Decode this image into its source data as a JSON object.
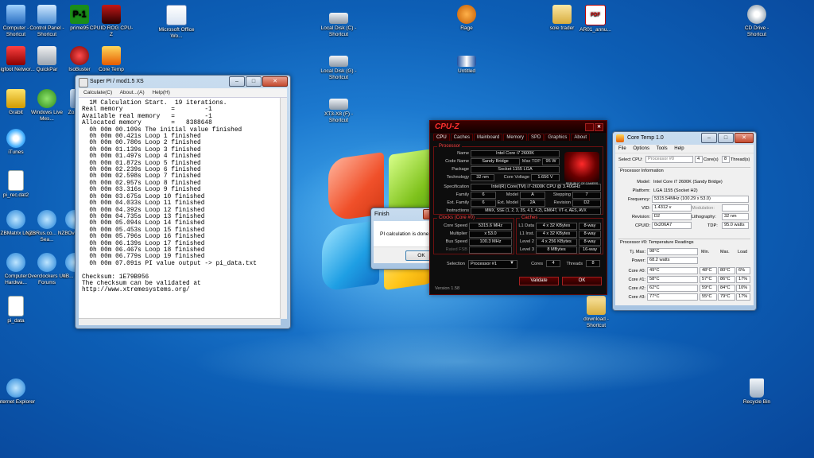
{
  "desktop_icons": [
    {
      "label": "Computer - Shortcut",
      "icon": "computer-icon"
    },
    {
      "label": "Control Panel - Shortcut",
      "icon": "control-panel-icon"
    },
    {
      "label": "prime95",
      "icon": "prime95-icon"
    },
    {
      "label": "CPUID ROG CPU-Z",
      "icon": "cpuz-rog-icon"
    },
    {
      "label": "Microsoft Office Wo...",
      "icon": "word-document-icon"
    },
    {
      "label": "Local Disk (C) - Shortcut",
      "icon": "drive-icon"
    },
    {
      "label": "Rage",
      "icon": "rage-icon"
    },
    {
      "label": "sole trader",
      "icon": "folder-icon"
    },
    {
      "label": "AR01_annu...",
      "icon": "pdf-icon"
    },
    {
      "label": "CD Drive - Shortcut",
      "icon": "cd-drive-icon"
    },
    {
      "label": "Bigfoot Networ...",
      "icon": "bigfoot-icon"
    },
    {
      "label": "QuickPar",
      "icon": "quickpar-icon"
    },
    {
      "label": "IsoBuster",
      "icon": "isobuster-icon"
    },
    {
      "label": "Core Temp",
      "icon": "core-temp-icon"
    },
    {
      "label": "Local Disk (G) - Shortcut",
      "icon": "drive-icon"
    },
    {
      "label": "Untitled",
      "icon": "image-icon"
    },
    {
      "label": "Grabit",
      "icon": "grabit-icon"
    },
    {
      "label": "Windows Live Mes...",
      "icon": "messenger-icon"
    },
    {
      "label": "Zo... Ho...",
      "icon": "app-icon"
    },
    {
      "label": "XT3-X8 (F) - Shortcut",
      "icon": "drive-icon"
    },
    {
      "label": "iTunes",
      "icon": "itunes-icon"
    },
    {
      "label": "pi_rec.dat2",
      "icon": "file-icon"
    },
    {
      "label": "NZBMatrix Login",
      "icon": "ie-icon"
    },
    {
      "label": "NZBRus.co... NZB Sea...",
      "icon": "ie-icon"
    },
    {
      "label": "Ove...",
      "icon": "ie-icon"
    },
    {
      "label": "Computer Hardwa...",
      "icon": "ie-icon"
    },
    {
      "label": "Overclockers UK Forums",
      "icon": "ie-icon"
    },
    {
      "label": "eB... the...",
      "icon": "ie-icon"
    },
    {
      "label": "pi_data",
      "icon": "file-icon"
    },
    {
      "label": "download - Shortcut",
      "icon": "download-icon"
    },
    {
      "label": "Internet Explorer",
      "icon": "ie-icon"
    },
    {
      "label": "Recycle Bin",
      "icon": "recycle-bin-icon"
    }
  ],
  "superpi": {
    "title": "Super PI / mod1.5 XS",
    "menu": [
      "Calculate(C)",
      "About...(A)",
      "Help(H)"
    ],
    "lines": [
      "  1M Calculation Start.  19 iterations.",
      "Real memory             =        -1",
      "Available real memory   =        -1",
      "Allocated memory        =   8388648",
      "  0h 00m 00.109s The initial value finished",
      "  0h 00m 00.421s Loop 1 finished",
      "  0h 00m 00.780s Loop 2 finished",
      "  0h 00m 01.139s Loop 3 finished",
      "  0h 00m 01.497s Loop 4 finished",
      "  0h 00m 01.872s Loop 5 finished",
      "  0h 00m 02.239s Loop 6 finished",
      "  0h 00m 02.598s Loop 7 finished",
      "  0h 00m 02.957s Loop 8 finished",
      "  0h 00m 03.316s Loop 9 finished",
      "  0h 00m 03.675s Loop 10 finished",
      "  0h 00m 04.033s Loop 11 finished",
      "  0h 00m 04.392s Loop 12 finished",
      "  0h 00m 04.735s Loop 13 finished",
      "  0h 00m 05.094s Loop 14 finished",
      "  0h 00m 05.453s Loop 15 finished",
      "  0h 00m 05.796s Loop 16 finished",
      "  0h 00m 06.139s Loop 17 finished",
      "  0h 00m 06.467s Loop 18 finished",
      "  0h 00m 06.779s Loop 19 finished",
      "  0h 00m 07.091s PI value output -> pi_data.txt",
      "",
      "Checksum: 1E79B956",
      "The checksum can be validated at",
      "http://www.xtremesystems.org/"
    ]
  },
  "finish_dialog": {
    "title": "Finish",
    "message": "PI calculation is done!",
    "ok_label": "OK"
  },
  "cpuz": {
    "title": "CPU-Z",
    "tabs": [
      "CPU",
      "Caches",
      "Mainboard",
      "Memory",
      "SPD",
      "Graphics",
      "About"
    ],
    "processor_legend": "Processor",
    "name_label": "Name",
    "name": "Intel Core i7 2600K",
    "codename_label": "Code Name",
    "codename": "Sandy Bridge",
    "maxtdp_label": "Max TDP",
    "maxtdp": "95 W",
    "package_label": "Package",
    "package": "Socket 1155 LGA",
    "technology_label": "Technology",
    "technology": "32 nm",
    "corevoltage_label": "Core Voltage",
    "corevoltage": "1.656 V",
    "spec_label": "Specification",
    "spec": "Intel(R) Core(TM) i7-2600K CPU @ 3.40GHz",
    "family_label": "Family",
    "family": "6",
    "model_label": "Model",
    "model": "A",
    "stepping_label": "Stepping",
    "stepping": "7",
    "extfamily_label": "Ext. Family",
    "extfamily": "6",
    "extmodel_label": "Ext. Model",
    "extmodel": "2A",
    "revision_label": "Revision",
    "revision": "D2",
    "instructions_label": "Instructions",
    "instructions": "MMX, SSE (1, 2, 3, 3S, 4.1, 4.2), EM64T, VT-x, AES, AVX",
    "clocks_legend": "Clocks (Core #0)",
    "corespeed_label": "Core Speed",
    "corespeed": "5315.6 MHz",
    "multiplier_label": "Multiplier",
    "multiplier": "x 53.0",
    "busspeed_label": "Bus Speed",
    "busspeed": "100.3 MHz",
    "ratedfsb_label": "Rated FSB",
    "ratedfsb": "",
    "caches_legend": "Caches",
    "l1data_label": "L1 Data",
    "l1data": "4 x 32 KBytes",
    "l1data_way": "8-way",
    "l1inst_label": "L1 Inst.",
    "l1inst": "4 x 32 KBytes",
    "l1inst_way": "8-way",
    "level2_label": "Level 2",
    "level2": "4 x 256 KBytes",
    "level2_way": "8-way",
    "level3_label": "Level 3",
    "level3": "8 MBytes",
    "level3_way": "16-way",
    "selection_label": "Selection",
    "selection": "Processor #1",
    "cores_label": "Cores",
    "cores": "4",
    "threads_label": "Threads",
    "threads": "8",
    "version": "Version 1.58",
    "validate_label": "Validate",
    "ok_label": "OK",
    "logo_text": "REPUBLIC OF GAMERS"
  },
  "coretemp": {
    "title": "Core Temp 1.0",
    "menu": [
      "File",
      "Options",
      "Tools",
      "Help"
    ],
    "select_cpu_label": "Select CPU:",
    "select_cpu": "Processor #0",
    "cores_value": "4",
    "cores_label": "Core(s)",
    "threads_value": "8",
    "threads_label": "Thread(s)",
    "info_header": "Processor Information",
    "model_label": "Model:",
    "model": "Intel Core i7 2600K (Sandy Bridge)",
    "platform_label": "Platform:",
    "platform": "LGA 1155 (Socket H2)",
    "frequency_label": "Frequency:",
    "frequency": "5315.54MHz (100.29 x 53.0)",
    "vid_label": "VID:",
    "vid": "1.4312 v",
    "modulation_label": "Modulation:",
    "modulation": "",
    "revision_label": "Revision:",
    "revision": "D2",
    "lithography_label": "Lithography:",
    "lithography": "32 nm",
    "cpuid_label": "CPUID:",
    "cpuid": "0x206A7",
    "tdp_label": "TDP:",
    "tdp": "95.0 watts",
    "temp_header": "Processor #0: Temperature Readings",
    "tjmax_label": "Tj. Max:",
    "tjmax": "98°C",
    "col_min": "Min.",
    "col_max": "Max.",
    "col_load": "Load",
    "power_label": "Power:",
    "power": "68.2 watts",
    "cores": [
      {
        "label": "Core #0:",
        "temp": "49°C",
        "min": "48°C",
        "max": "80°C",
        "load": "6%"
      },
      {
        "label": "Core #1:",
        "temp": "58°C",
        "min": "57°C",
        "max": "86°C",
        "load": "17%"
      },
      {
        "label": "Core #2:",
        "temp": "62°C",
        "min": "59°C",
        "max": "84°C",
        "load": "10%"
      },
      {
        "label": "Core #3:",
        "temp": "77°C",
        "min": "55°C",
        "max": "79°C",
        "load": "17%"
      }
    ]
  },
  "colors": {
    "desktop_bg": "#0d5fb6",
    "cpuz_accent": "#ff3030",
    "aero_frame": "#b3cce6"
  }
}
